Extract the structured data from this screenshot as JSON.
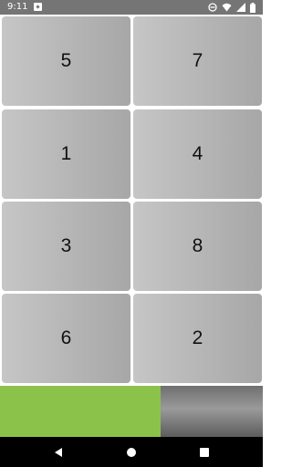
{
  "status_bar": {
    "time": "9:11",
    "icons": [
      "app-notification-icon",
      "do-not-disturb-icon",
      "wifi-icon",
      "cell-signal-icon",
      "battery-icon"
    ]
  },
  "tiles": [
    "5",
    "7",
    "1",
    "4",
    "3",
    "8",
    "6",
    "2"
  ],
  "progress": {
    "fraction": 0.61,
    "fill_color": "#8bc34a"
  },
  "nav_bar": {
    "icons": [
      "back-icon",
      "home-icon",
      "recents-icon"
    ]
  },
  "colors": {
    "status_bar": "#757575",
    "tile_light": "#c6c6c6",
    "tile_dark": "#a7a7a7",
    "nav_bar": "#000000"
  }
}
